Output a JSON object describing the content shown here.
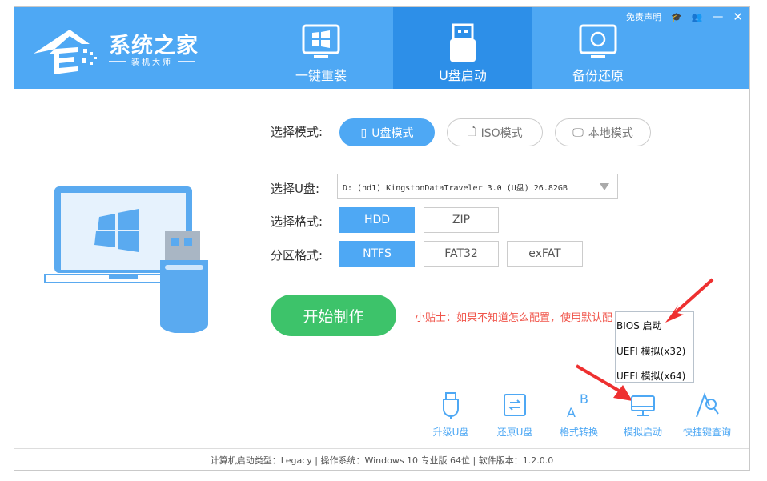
{
  "app": {
    "brand": "系统之家",
    "subtitle": "装机大师"
  },
  "titlebar": {
    "disclaimer": "免责声明"
  },
  "tabs": [
    {
      "label": "一键重装"
    },
    {
      "label": "U盘启动"
    },
    {
      "label": "备份还原"
    }
  ],
  "mode": {
    "label": "选择模式:",
    "options": [
      "U盘模式",
      "ISO模式",
      "本地模式"
    ],
    "selected": "U盘模式"
  },
  "disk": {
    "label": "选择U盘:",
    "value": "D: (hd1) KingstonDataTraveler 3.0 (U盘) 26.82GB"
  },
  "format": {
    "label": "选择格式:",
    "options": [
      "HDD",
      "ZIP"
    ],
    "selected": "HDD"
  },
  "partition": {
    "label": "分区格式:",
    "options": [
      "NTFS",
      "FAT32",
      "exFAT"
    ],
    "selected": "NTFS"
  },
  "start_label": "开始制作",
  "tip": "小贴士：如果不知道怎么配置，使用默认配",
  "popup": [
    "BIOS 启动",
    "UEFI 模拟(x32)",
    "UEFI 模拟(x64)"
  ],
  "tools": [
    "升级U盘",
    "还原U盘",
    "格式转换",
    "模拟启动",
    "快捷键查询"
  ],
  "footer": "计算机启动类型：Legacy | 操作系统：Windows 10 专业版 64位 | 软件版本：1.2.0.0",
  "colors": {
    "primary": "#4ea8f4",
    "active_tab": "#2d8fe8",
    "start": "#3dc36a",
    "tip": "#f0544a",
    "arrow": "#ee3030"
  }
}
